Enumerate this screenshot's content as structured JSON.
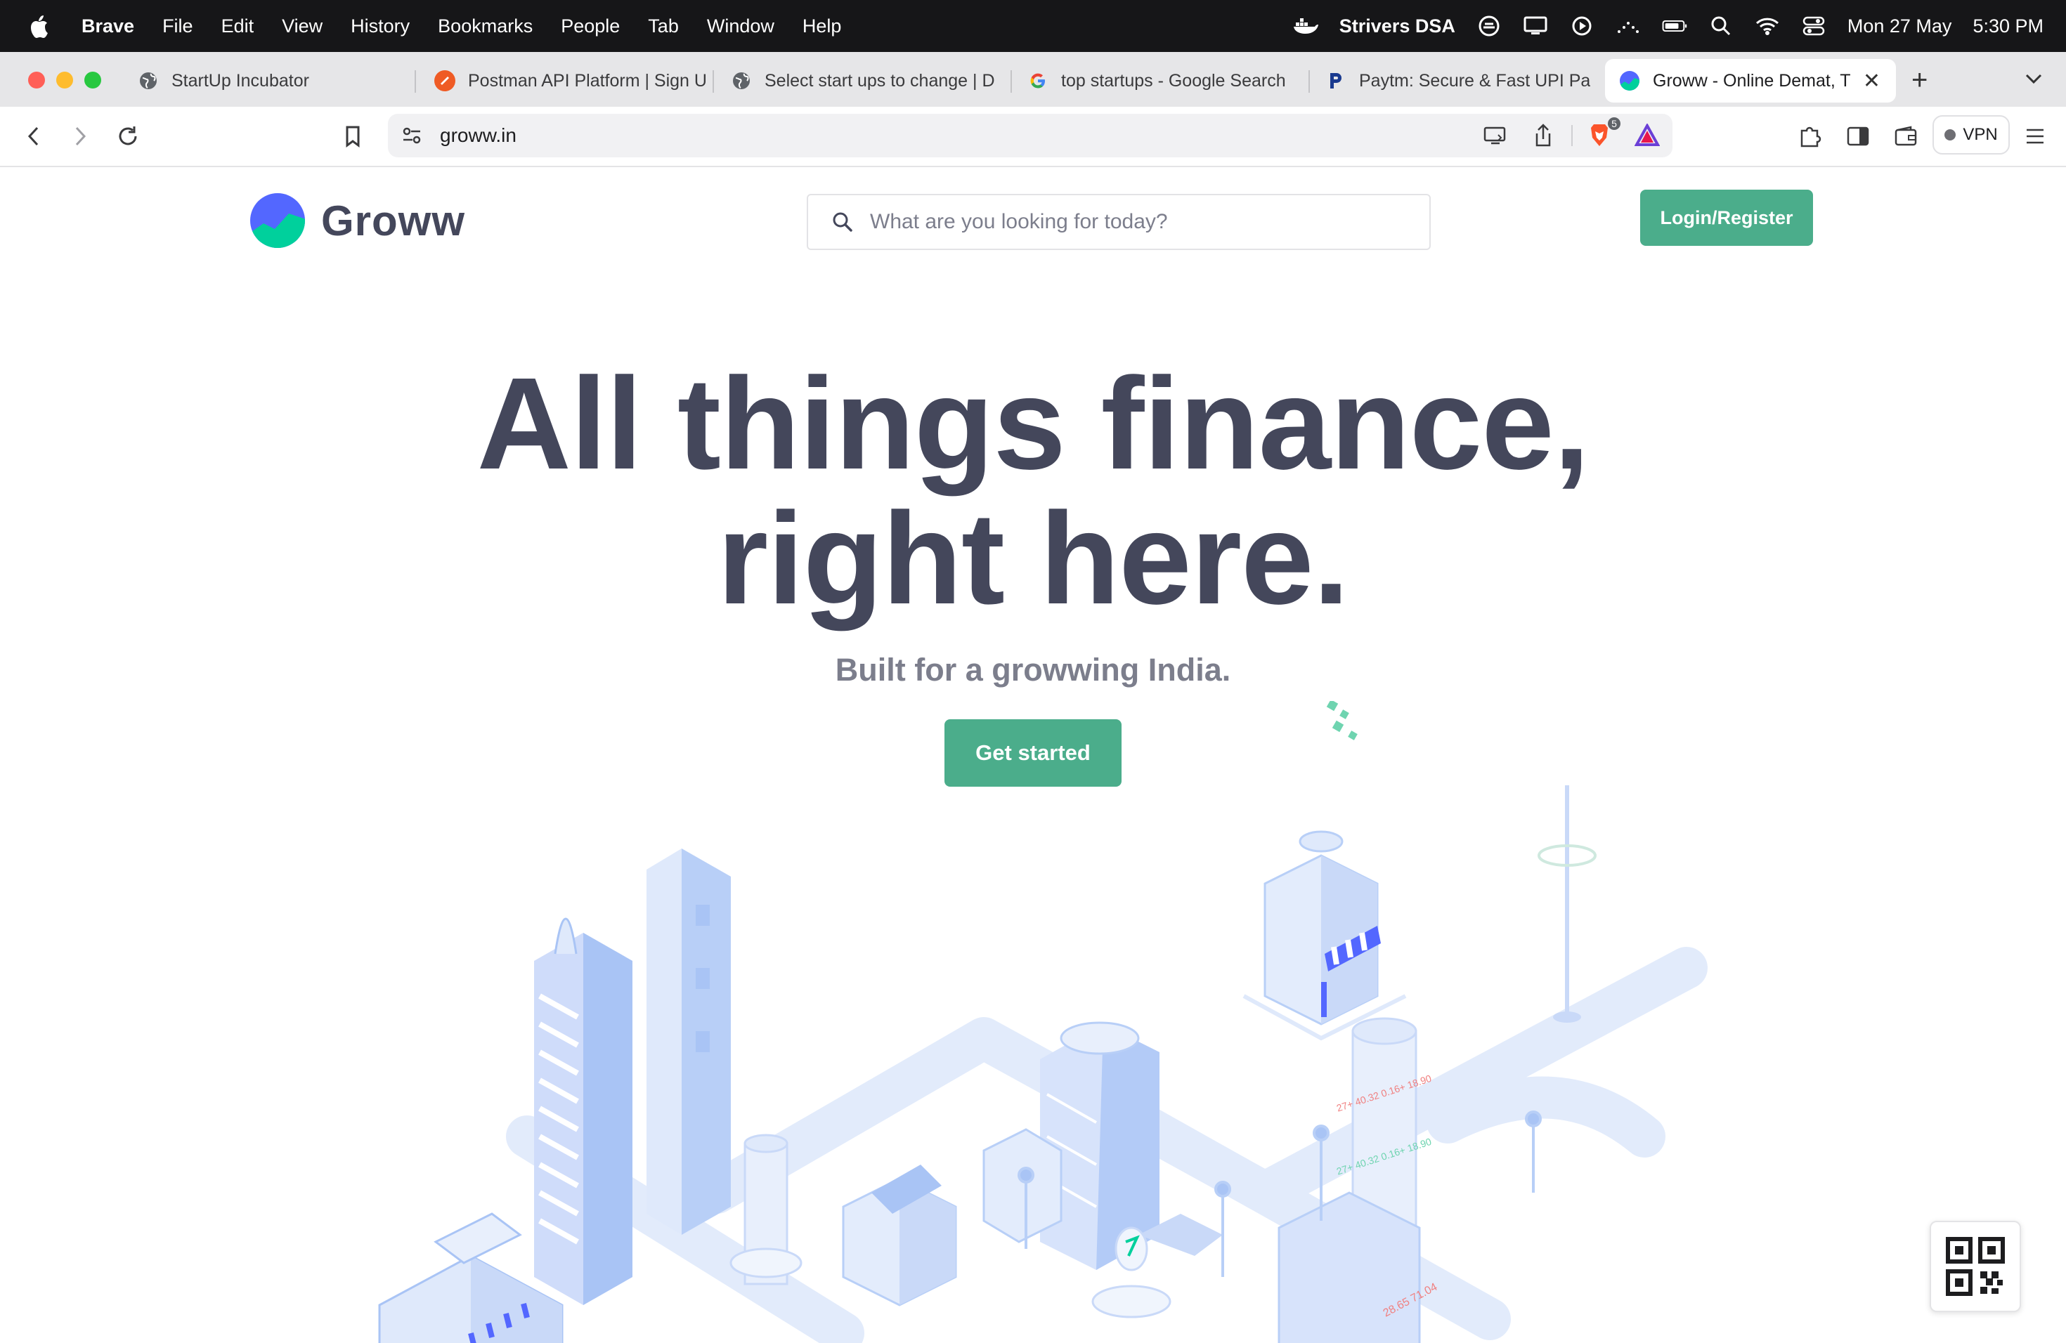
{
  "menubar": {
    "app_name": "Brave",
    "menus": [
      "File",
      "Edit",
      "View",
      "History",
      "Bookmarks",
      "People",
      "Tab",
      "Window",
      "Help"
    ],
    "status_label": "Strivers DSA",
    "date": "Mon 27 May",
    "time": "5:30 PM"
  },
  "tabs": [
    {
      "title": "StartUp Incubator",
      "icon": "globe-icon"
    },
    {
      "title": "Postman API Platform | Sign U",
      "icon": "postman-icon"
    },
    {
      "title": "Select start ups to change | D",
      "icon": "globe-icon"
    },
    {
      "title": "top startups - Google Search",
      "icon": "google-icon"
    },
    {
      "title": "Paytm: Secure & Fast UPI Pa",
      "icon": "paytm-icon"
    },
    {
      "title": "Groww - Online Demat, T",
      "icon": "groww-icon",
      "active": true
    }
  ],
  "toolbar": {
    "url": "groww.in",
    "shield_badge": "5",
    "vpn_label": "VPN"
  },
  "site": {
    "brand": "Groww",
    "search_placeholder": "What are you looking for today?",
    "login_label": "Login/Register",
    "hero_line1": "All things finance,",
    "hero_line2": "right here.",
    "tagline": "Built for a growwing India.",
    "cta_label": "Get started"
  },
  "colors": {
    "brand_green": "#4bad8b",
    "heading": "#44475b",
    "subtle_text": "#7c7e8c",
    "illustration_blue": "#a9c4f5"
  }
}
